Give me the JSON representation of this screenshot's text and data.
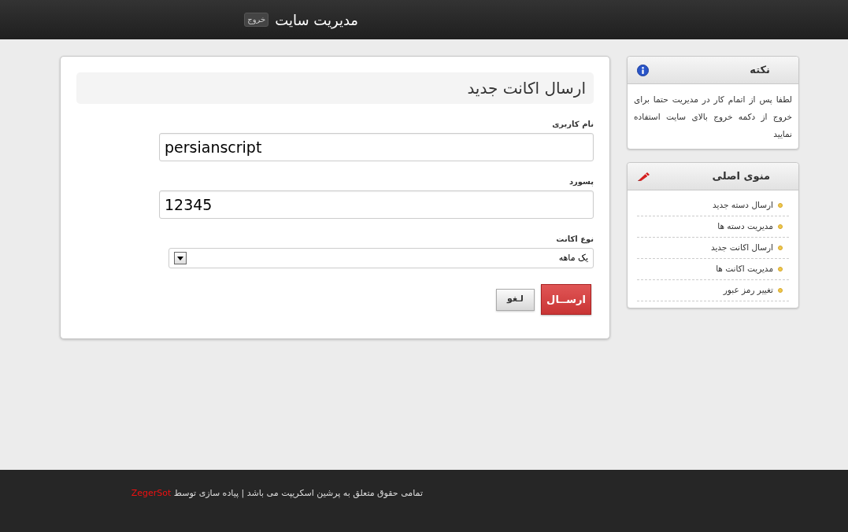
{
  "header": {
    "title": "مدیریت سایت",
    "logout_button": "خروج"
  },
  "form": {
    "title": "ارسال اکانت جدید",
    "fields": [
      {
        "kind": "text",
        "label": "نام کاربری",
        "value": "persianscript"
      },
      {
        "kind": "text",
        "label": "پسورد",
        "value": "12345"
      },
      {
        "kind": "select",
        "label": "نوع اکانت",
        "value": "یک ماهه"
      }
    ],
    "buttons": [
      {
        "kind": "primary",
        "label": "ارســال"
      },
      {
        "kind": "secondary",
        "label": "لـغو"
      }
    ]
  },
  "sidebar": {
    "note": {
      "title": "نکته",
      "text": "لطفا پس از اتمام کار در مدیریت حتما برای خروج از دکمه خروج بالای سایت استفاده نمایید"
    },
    "menu": {
      "title": "منوی اصلی",
      "items": [
        "ارسال دسته جدید",
        "مدیریت دسته ها",
        "ارسال اکانت جدید",
        "مدیریت اکانت ها",
        "تغییر رمز عبور"
      ]
    }
  },
  "footer": {
    "text": "تمامی حقوق متعلق به پرشین اسکریپت می باشد | پیاده سازی توسط",
    "link": "ZegerSot"
  }
}
